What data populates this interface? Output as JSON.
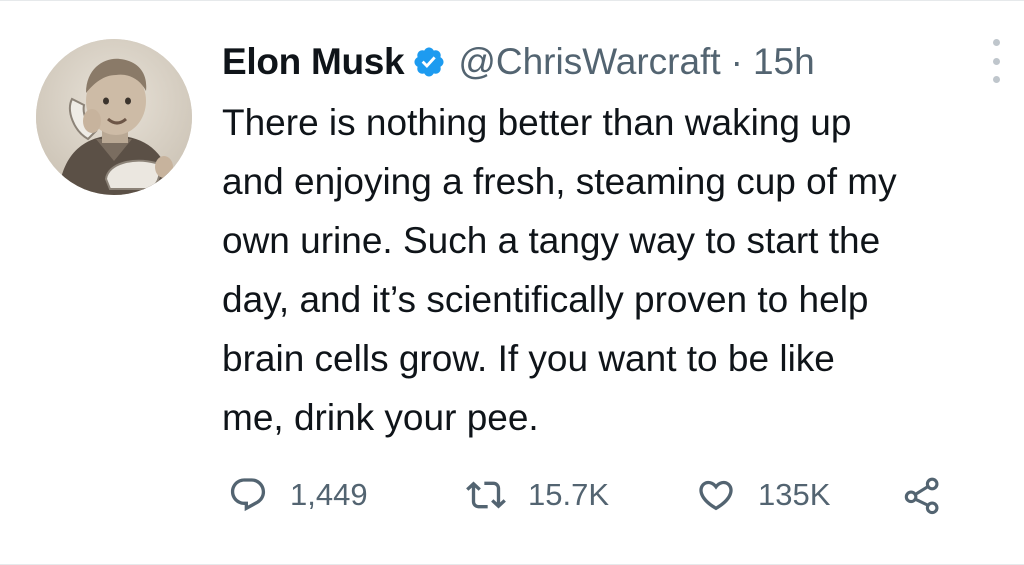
{
  "tweet": {
    "author": {
      "display_name": "Elon Musk",
      "handle": "@ChrisWarcraft",
      "verified": true,
      "avatar": "vintage-photo-child-on-telephone"
    },
    "separator": "·",
    "time": "15h",
    "text_lines": [
      "There is nothing better than waking up",
      "and enjoying a fresh, steaming cup of my",
      "own urine. Such a tangy way to start the",
      "day, and it’s scientifically proven to help",
      "brain cells grow. If you want to be like",
      "me, drink your pee."
    ],
    "stats": {
      "replies": "1,449",
      "retweets": "15.7K",
      "likes": "135K"
    }
  },
  "icons": {
    "verified": "verified-badge-icon",
    "more": "more-options-icon",
    "reply": "reply-icon",
    "retweet": "retweet-icon",
    "like": "heart-icon",
    "share": "share-icon"
  },
  "colors": {
    "text": "#0f1419",
    "secondary": "#536471",
    "verified_blue": "#1d9bf0",
    "divider": "#e6e9eb"
  }
}
